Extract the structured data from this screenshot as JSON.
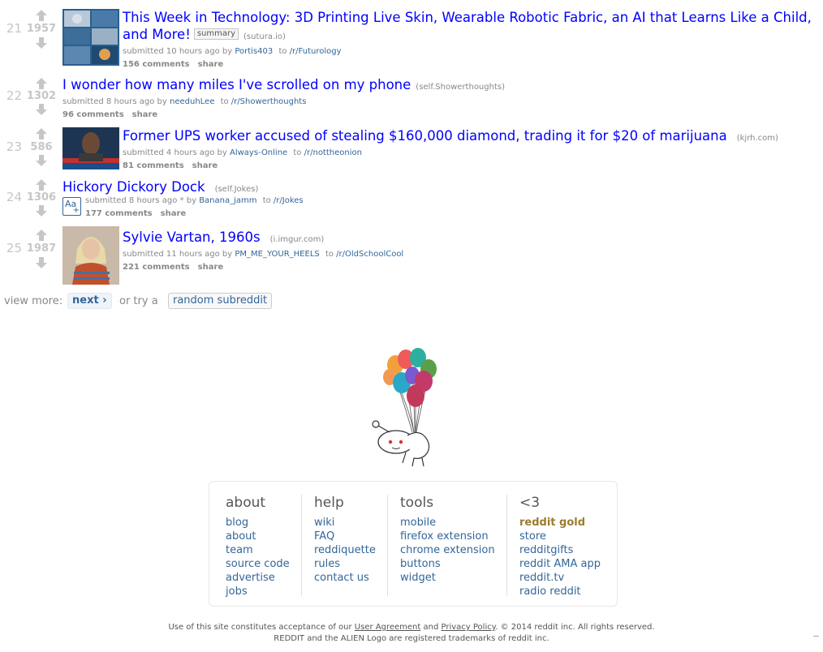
{
  "posts": [
    {
      "rank": "21",
      "score": "1957",
      "title": "This Week in Technology: 3D Printing Live Skin, Wearable Robotic Fabric, an AI that Learns Like a Child, and More!",
      "summary_tag": "summary",
      "domain": "(sutura.io)",
      "submitted": "submitted 10 hours ago by",
      "author": "Portis403",
      "to": "to",
      "subreddit": "/r/Futurology",
      "comments": "156 comments",
      "share": "share",
      "thumbnail": "tech-collage-thumbnail"
    },
    {
      "rank": "22",
      "score": "1302",
      "title": "I wonder how many miles I've scrolled on my phone",
      "domain": "(self.Showerthoughts)",
      "submitted": "submitted 8 hours ago by",
      "author": "needuhLee",
      "to": "to",
      "subreddit": "/r/Showerthoughts",
      "comments": "96 comments",
      "share": "share"
    },
    {
      "rank": "23",
      "score": "586",
      "title": "Former UPS worker accused of stealing $160,000 diamond, trading it for $20 of marijuana",
      "domain": "(kjrh.com)",
      "submitted": "submitted 4 hours ago by",
      "author": "Always-Online",
      "to": "to",
      "subreddit": "/r/nottheonion",
      "comments": "81 comments",
      "share": "share",
      "thumbnail": "news-portrait-thumbnail"
    },
    {
      "rank": "24",
      "score": "1306",
      "title": "Hickory Dickory Dock",
      "domain": "(self.Jokes)",
      "submitted": "submitted 8 hours ago * by",
      "author": "Banana_jamm",
      "to": "to",
      "subreddit": "/r/Jokes",
      "comments": "177 comments",
      "share": "share",
      "self_icon": "Aa",
      "self_icon_plus": "+"
    },
    {
      "rank": "25",
      "score": "1987",
      "title": "Sylvie Vartan, 1960s",
      "domain": "(i.imgur.com)",
      "submitted": "submitted 11 hours ago by",
      "author": "PM_ME_YOUR_HEELS",
      "to": "to",
      "subreddit": "/r/OldSchoolCool",
      "comments": "221 comments",
      "share": "share",
      "thumbnail": "portrait-photo-thumbnail"
    }
  ],
  "pagination": {
    "view_more": "view more:",
    "next": "next ›",
    "or_try": "or try a",
    "random": "random subreddit"
  },
  "footer": {
    "columns": [
      {
        "head": "about",
        "items": [
          "blog",
          "about",
          "team",
          "source code",
          "advertise",
          "jobs"
        ]
      },
      {
        "head": "help",
        "items": [
          "wiki",
          "FAQ",
          "reddiquette",
          "rules",
          "contact us"
        ]
      },
      {
        "head": "tools",
        "items": [
          "mobile",
          "firefox extension",
          "chrome extension",
          "buttons",
          "widget"
        ]
      },
      {
        "head": "<3",
        "items": [
          "reddit gold",
          "store",
          "redditgifts",
          "reddit AMA app",
          "reddit.tv",
          "radio reddit"
        ]
      }
    ]
  },
  "legal": {
    "use_prefix": "Use of this site constitutes acceptance of our",
    "user_agreement": "User Agreement",
    "and": "and",
    "privacy_policy": "Privacy Policy",
    "copyright": ". © 2014 reddit inc. All rights reserved.",
    "trademark": "REDDIT and the ALIEN Logo are registered trademarks of reddit inc."
  },
  "colors": {
    "title_link": "#0000ff",
    "meta_link": "#336699",
    "gold": "#9a7d2e",
    "muted": "#c6c6c6"
  }
}
